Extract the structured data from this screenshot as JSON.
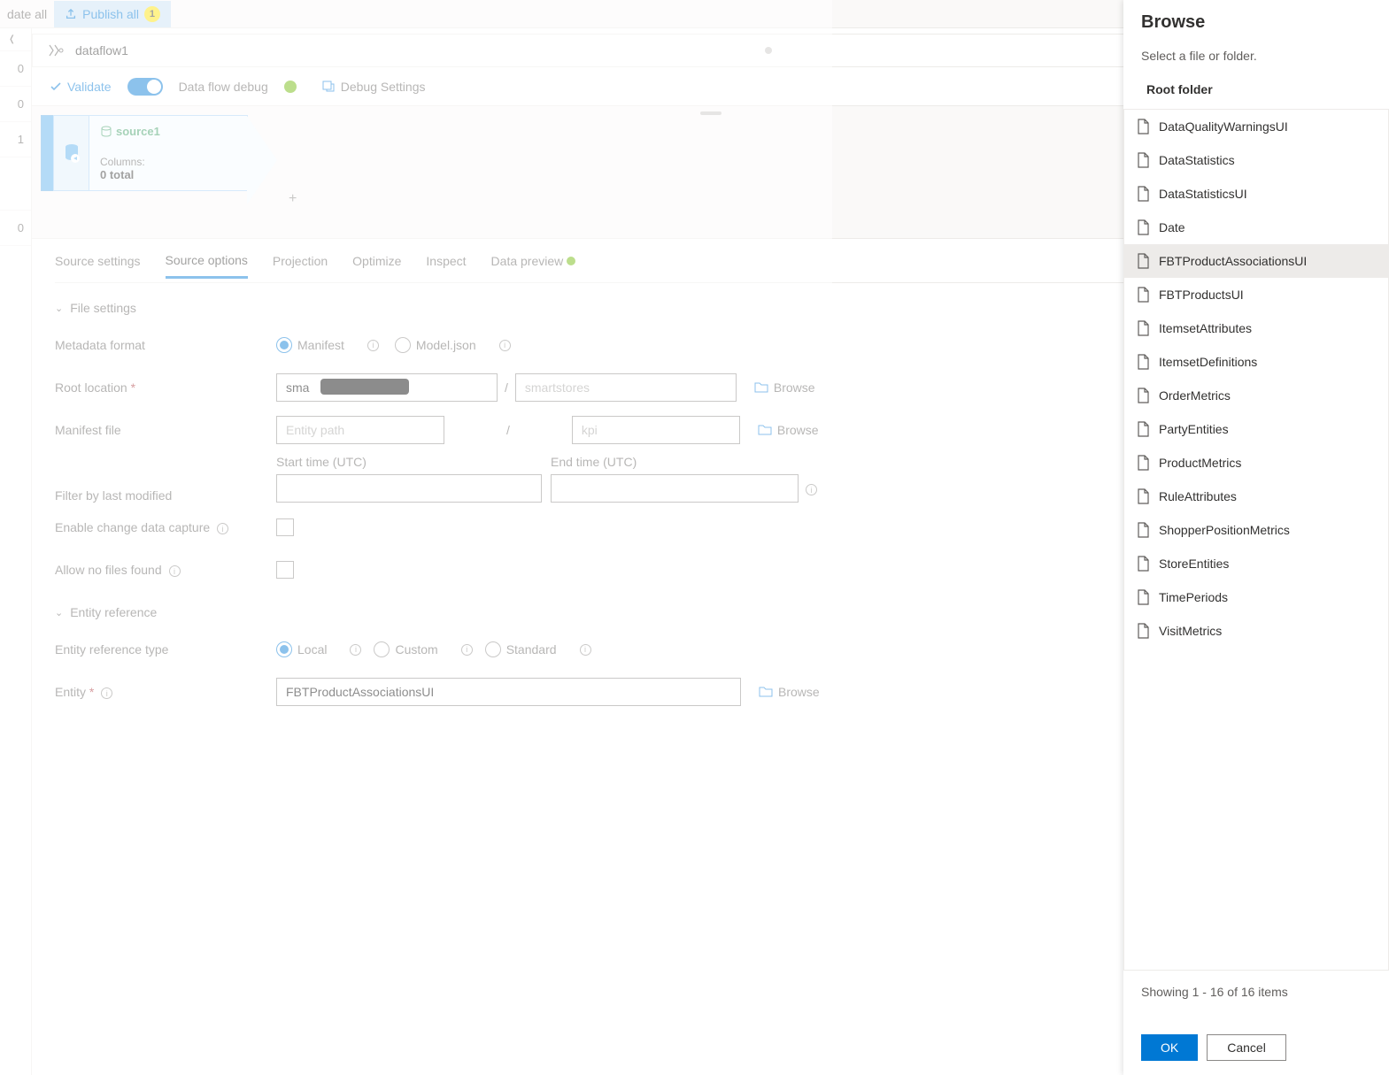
{
  "topbar": {
    "date_all": "date all",
    "publish": "Publish all",
    "publish_count": "1"
  },
  "left_rail": [
    "0",
    "0",
    "1",
    "",
    "0"
  ],
  "dataflow": {
    "name": "dataflow1"
  },
  "actions": {
    "validate": "Validate",
    "debug": "Data flow debug",
    "debug_settings": "Debug Settings"
  },
  "node": {
    "title": "source1",
    "cols_label": "Columns:",
    "total": "0 total"
  },
  "tabs": [
    "Source settings",
    "Source options",
    "Projection",
    "Optimize",
    "Inspect",
    "Data preview"
  ],
  "active_tab": 1,
  "sections": {
    "file_settings": "File settings",
    "entity_ref": "Entity reference"
  },
  "form": {
    "metadata_format": "Metadata format",
    "manifest": "Manifest",
    "modeljson": "Model.json",
    "root_location": "Root location",
    "root_val": "sma",
    "root_placeholder2": "smartstores",
    "manifest_file": "Manifest file",
    "entity_path_ph": "Entity path",
    "kpi_ph": "kpi",
    "browse": "Browse",
    "filter_lbl": "Filter by last modified",
    "start": "Start time (UTC)",
    "end": "End time (UTC)",
    "enable_cdc": "Enable change data capture",
    "allow_no_files": "Allow no files found",
    "entity_ref_type": "Entity reference type",
    "local": "Local",
    "custom": "Custom",
    "standard": "Standard",
    "entity": "Entity",
    "entity_val": "FBTProductAssociationsUI"
  },
  "panel": {
    "title": "Browse",
    "subtitle": "Select a file or folder.",
    "root": "Root folder",
    "items": [
      "DataQualityWarningsUI",
      "DataStatistics",
      "DataStatisticsUI",
      "Date",
      "FBTProductAssociationsUI",
      "FBTProductsUI",
      "ItemsetAttributes",
      "ItemsetDefinitions",
      "OrderMetrics",
      "PartyEntities",
      "ProductMetrics",
      "RuleAttributes",
      "ShopperPositionMetrics",
      "StoreEntities",
      "TimePeriods",
      "VisitMetrics"
    ],
    "selected": "FBTProductAssociationsUI",
    "showing": "Showing 1 - 16 of 16 items",
    "ok": "OK",
    "cancel": "Cancel"
  }
}
